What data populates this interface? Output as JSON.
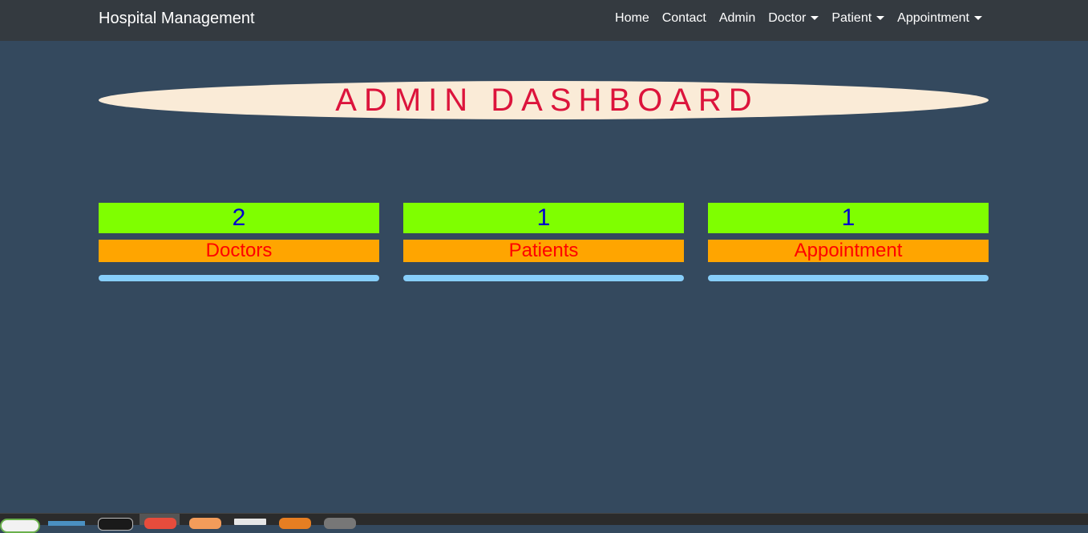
{
  "navbar": {
    "brand": "Hospital Management",
    "links": [
      {
        "label": "Home",
        "dropdown": false
      },
      {
        "label": "Contact",
        "dropdown": false
      },
      {
        "label": "Admin",
        "dropdown": false
      },
      {
        "label": "Doctor",
        "dropdown": true
      },
      {
        "label": "Patient",
        "dropdown": true
      },
      {
        "label": "Appointment",
        "dropdown": true
      }
    ]
  },
  "dashboard": {
    "title": "ADMIN DASHBOARD",
    "cards": [
      {
        "count": "2",
        "label": "Doctors"
      },
      {
        "count": "1",
        "label": "Patients"
      },
      {
        "count": "1",
        "label": "Appointment"
      }
    ]
  },
  "colors": {
    "background": "#34495e",
    "navbar": "#343a40",
    "title_bg": "#faebd7",
    "title_text": "#dc143c",
    "count_bg": "#7fff00",
    "count_text": "#0000cd",
    "label_bg": "#ffa500",
    "label_text": "#ff0000",
    "bar": "#87cefa"
  },
  "taskbar": {
    "icons": [
      "app-icon",
      "terminal-icon",
      "editor-icon",
      "browser-icon",
      "files-icon",
      "folder-icon",
      "vlc-icon",
      "settings-icon"
    ]
  }
}
